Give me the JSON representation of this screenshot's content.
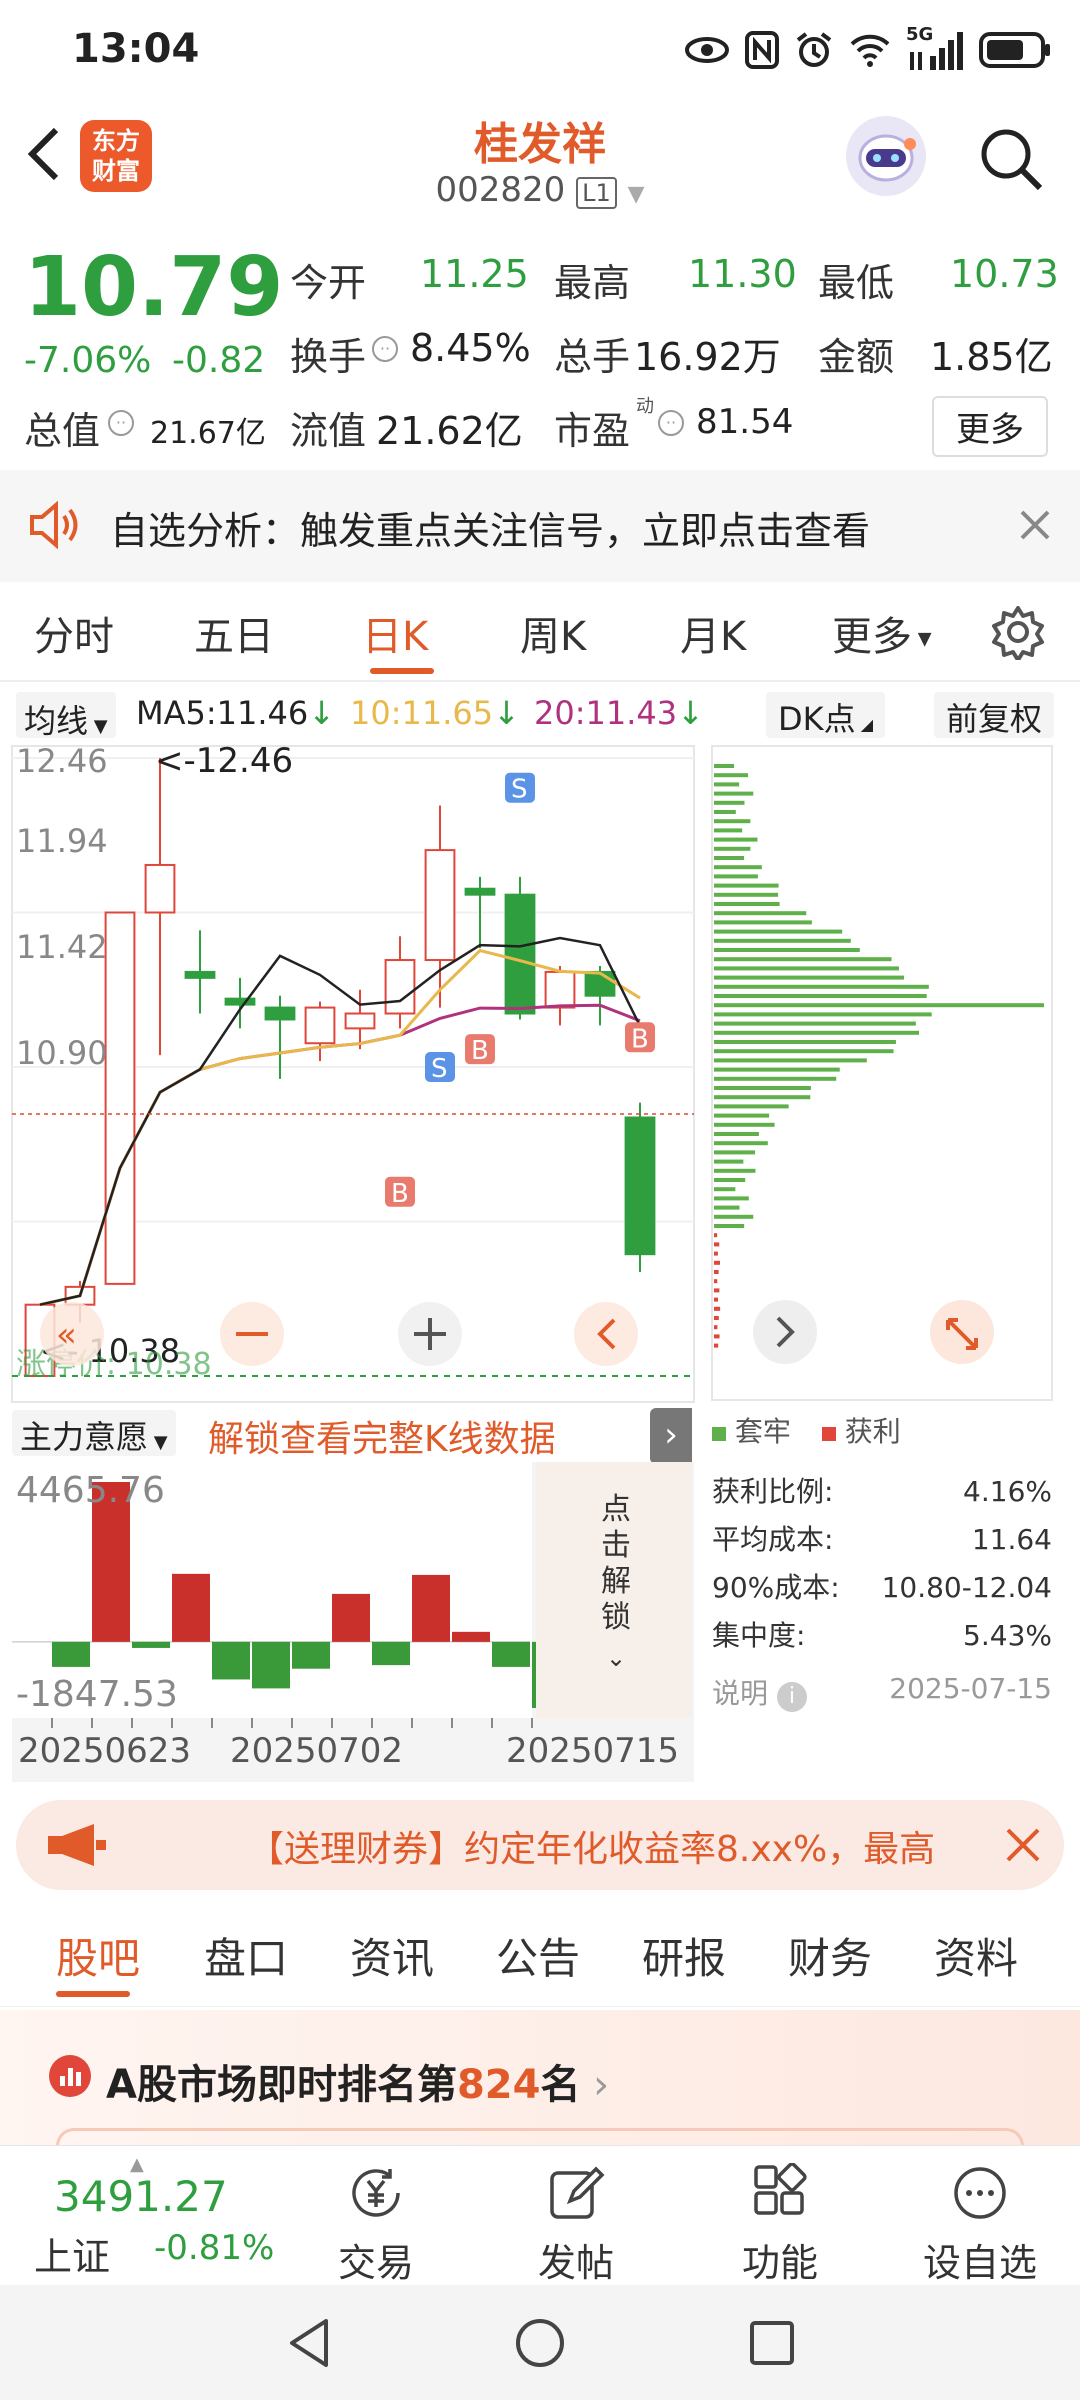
{
  "status": {
    "time": "13:04",
    "network": "5G"
  },
  "header": {
    "title": "桂发祥",
    "code": "002820",
    "level_badge": "L1",
    "logo_line1": "东方",
    "logo_line2": "财富"
  },
  "quote": {
    "price": "10.79",
    "change_pct": "-7.06%",
    "change": "-0.82",
    "open_label": "今开",
    "open": "11.25",
    "high_label": "最高",
    "high": "11.30",
    "low_label": "最低",
    "low": "10.73",
    "turnover_label": "换手",
    "turnover": "8.45%",
    "volume_label": "总手",
    "volume": "16.92万",
    "amount_label": "金额",
    "amount": "1.85亿",
    "mktcap_label": "总值",
    "mktcap": "21.67亿",
    "float_label": "流值",
    "float": "21.62亿",
    "pe_label": "市盈",
    "pe_sup": "动",
    "pe": "81.54",
    "more_button": "更多"
  },
  "notice": {
    "text": "自选分析：触发重点关注信号，立即点击查看"
  },
  "tabs": [
    "分时",
    "五日",
    "日K",
    "周K",
    "月K",
    "更多"
  ],
  "active_tab": "日K",
  "kline": {
    "ma_selector": "均线",
    "ma5": "MA5:11.46",
    "ma10": "10:11.65",
    "ma20": "20:11.43",
    "dk_button": "DK点",
    "adjust_button": "前复权",
    "y_labels": [
      "12.46",
      "11.94",
      "11.42",
      "10.90",
      "10.38"
    ],
    "max_marker": "<-12.46",
    "min_marker": "10.38",
    "low_marker_text": "涨停价: 10.38"
  },
  "chart_data": {
    "type": "candlestick",
    "ylim": [
      10.38,
      12.46
    ],
    "ma_values": {
      "MA5": 11.46,
      "MA10": 11.65,
      "MA20": 11.43
    },
    "candles": [
      {
        "o": 10.38,
        "c": 10.62,
        "h": 10.62,
        "l": 10.38
      },
      {
        "o": 10.62,
        "c": 10.68,
        "h": 10.7,
        "l": 10.56
      },
      {
        "o": 10.69,
        "c": 11.94,
        "h": 11.94,
        "l": 10.69
      },
      {
        "o": 11.94,
        "c": 12.1,
        "h": 12.46,
        "l": 11.46
      },
      {
        "o": 11.74,
        "c": 11.72,
        "h": 11.88,
        "l": 11.6
      },
      {
        "o": 11.65,
        "c": 11.63,
        "h": 11.72,
        "l": 11.55
      },
      {
        "o": 11.62,
        "c": 11.58,
        "h": 11.66,
        "l": 11.38
      },
      {
        "o": 11.5,
        "c": 11.62,
        "h": 11.64,
        "l": 11.44
      },
      {
        "o": 11.55,
        "c": 11.6,
        "h": 11.68,
        "l": 11.48
      },
      {
        "o": 11.6,
        "c": 11.78,
        "h": 11.86,
        "l": 11.55
      },
      {
        "o": 11.78,
        "c": 12.15,
        "h": 12.3,
        "l": 11.62
      },
      {
        "o": 12.02,
        "c": 12.0,
        "h": 12.06,
        "l": 11.82
      },
      {
        "o": 12.0,
        "c": 11.6,
        "h": 12.06,
        "l": 11.58
      },
      {
        "o": 11.62,
        "c": 11.74,
        "h": 11.76,
        "l": 11.56
      },
      {
        "o": 11.74,
        "c": 11.66,
        "h": 11.76,
        "l": 11.56
      },
      {
        "o": 11.25,
        "c": 10.79,
        "h": 11.3,
        "l": 10.73
      }
    ],
    "fund_flow": {
      "label": "主力意愿",
      "ymax": "4465.76",
      "ymin": "-1847.53",
      "values": [
        -700,
        4465.76,
        -170,
        1900,
        -1050,
        -1300,
        -750,
        1340,
        -650,
        1870,
        280,
        -700,
        -1847.53
      ],
      "x_labels": [
        "20250623",
        "20250702",
        "20250715"
      ]
    }
  },
  "unlock": {
    "banner": "解锁查看完整K线数据",
    "side": "点击解锁"
  },
  "chip": {
    "legend_trapped": "套牢",
    "legend_profit": "获利",
    "rows": [
      {
        "label": "获利比例:",
        "value": "4.16%"
      },
      {
        "label": "平均成本:",
        "value": "11.64"
      },
      {
        "label": "90%成本:",
        "value": "10.80-12.04"
      },
      {
        "label": "集中度:",
        "value": "5.43%"
      }
    ],
    "note_label": "说明",
    "date": "2025-07-15"
  },
  "promo": {
    "text": "【送理财券】约定年化收益率8.xx%，最高"
  },
  "bottom_tabs": [
    "股吧",
    "盘口",
    "资讯",
    "公告",
    "研报",
    "财务",
    "资料"
  ],
  "ranking": {
    "prefix": "A股市场即时排名第",
    "rank": "824",
    "suffix": "名"
  },
  "index": {
    "value": "3491.27",
    "name": "上证",
    "change": "-0.81%"
  },
  "nav": [
    "交易",
    "发帖",
    "功能",
    "设自选"
  ],
  "colors": {
    "up": "#e0463a",
    "down": "#2e9e3f",
    "accent": "#e05a2a",
    "ma5": "#222222",
    "ma10": "#e8b84a",
    "ma20": "#b0317e"
  }
}
